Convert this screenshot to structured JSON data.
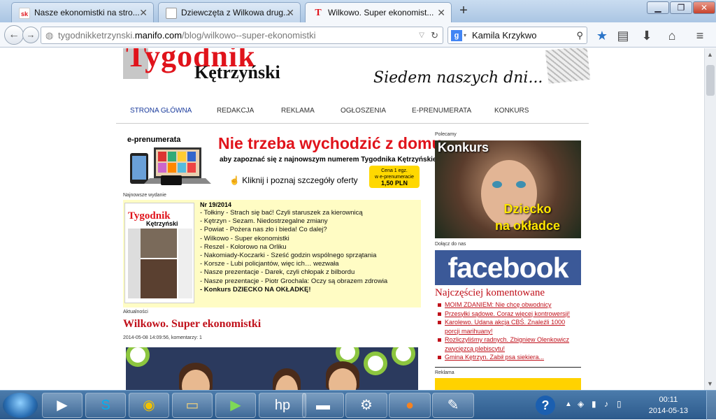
{
  "browser": {
    "tabs": [
      {
        "label": "Nasze ekonomistki na stro...",
        "icon": "sko-favicon"
      },
      {
        "label": "Dziewczęta z Wilkowa drug...",
        "icon": "page-favicon"
      },
      {
        "label": "Wilkowo. Super ekonomist...",
        "icon": "tk-favicon",
        "active": true
      }
    ],
    "new_tab": "+",
    "url_host": "tygodnikketrzynski.",
    "url_domain": "manifo.com",
    "url_path": "/blog/wilkowo--super-ekonomistki",
    "search_engine": "google",
    "search_value": "Kamila Krzykwo"
  },
  "site": {
    "logo_top": "Tygodnik",
    "logo_city": "Kętrzyński",
    "slogan": "Siedem naszych dni...",
    "menu": [
      "STRONA GŁÓWNA",
      "REDAKCJA",
      "REKLAMA",
      "OGŁOSZENIA",
      "E-PRENUMERATA",
      "KONKURS"
    ],
    "banner": {
      "eprenumerata": "e-prenumerata",
      "headline": "Nie trzeba wychodzić z domu",
      "sub": "aby zapoznać się z najnowszym numerem Tygodnika Kętrzyńskiego!",
      "click": "Kliknij i poznaj szczegóły oferty",
      "price_line1": "Cena 1 egz.",
      "price_line2": "w e-prenumeracie",
      "price_value": "1,50 PLN"
    },
    "newest_label": "Najnowsze wydanie",
    "issue": {
      "nr": "Nr 19/2014",
      "items": [
        "- Tołkiny - Strach się bać! Czyli staruszek za kierownicą",
        "- Kętrzyn - Sezam. Niedostrzegalne zmiany",
        "- Powiat - Pożera nas zło i bieda! Co dalej?",
        "- Wilkowo - Super ekonomistki",
        "- Reszel - Kolorowo na Orliku",
        "- Nakomiady-Koczarki - Sześć godzin wspólnego sprzątania",
        "- Korsze - Lubi policjantów, więc ich… wezwała",
        "- Nasze prezentacje - Darek, czyli chłopak z bilbordu",
        "- Nasze prezentacje - Piotr Grochala: Oczy są obrazem zdrowia"
      ],
      "last_item": "- Konkurs DZIECKO NA OKŁADKĘ!"
    },
    "news_label": "Aktualności",
    "article_title": "Wilkowo. Super ekonomistki",
    "article_meta": "2014-05-08 14:09:56, komentarzy: 1",
    "sidebar": {
      "polecamy": "Polecamy",
      "konkurs_title": "Konkurs",
      "konkurs_line1": "Dziecko",
      "konkurs_line2": "na okładce",
      "dolacz": "Dołącz do nas",
      "facebook": "facebook",
      "most_commented_title": "Najczęściej komentowane",
      "comments": [
        "MOIM ZDANIEM: Nie chcę obwodnicy",
        "Przesyłki sądowe. Coraz więcej kontrowersji!",
        "Karolewo. Udana akcja CBŚ. Znaleźli 1000 porcji marihuany!",
        "Rozliczyliśmy radnych. Zbigniew Olenkowicz zwycięzcą plebiscytu!",
        "Gmina Kętrzyn. Zabił psa siekiera..."
      ],
      "reklama": "Reklama"
    }
  },
  "taskbar": {
    "time": "00:11",
    "date": "2014-05-13"
  }
}
